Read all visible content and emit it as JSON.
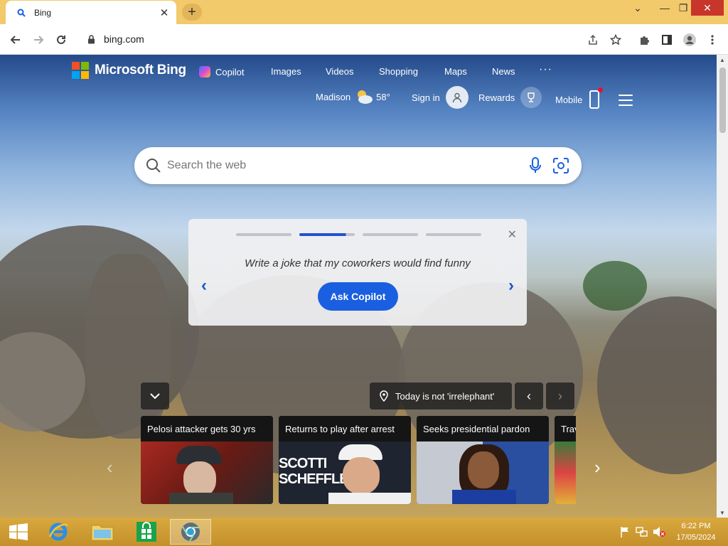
{
  "browser": {
    "tab_title": "Bing",
    "tab_close": "✕",
    "new_tab": "+",
    "url": "bing.com",
    "win_minimize": "—",
    "win_restore": "❐",
    "win_close": "✕",
    "win_dropdown": "⌄"
  },
  "bing": {
    "logo_text": "Microsoft Bing",
    "logo_colors": [
      "#f25022",
      "#7fba00",
      "#00a4ef",
      "#ffb900"
    ],
    "nav": {
      "copilot": "Copilot",
      "images": "Images",
      "videos": "Videos",
      "shopping": "Shopping",
      "maps": "Maps",
      "news": "News",
      "more": "···"
    },
    "weather": {
      "location": "Madison",
      "temp": "58°",
      "icon": "partly-cloudy-icon"
    },
    "sign_in": "Sign in",
    "rewards": "Rewards",
    "mobile": "Mobile"
  },
  "search": {
    "placeholder": "Search the web"
  },
  "copilot_card": {
    "prompt": "Write a joke that my coworkers would find funny",
    "button": "Ask Copilot",
    "close": "✕",
    "prev": "‹",
    "next": "›",
    "active_index": 1,
    "slide_count": 4
  },
  "fact": {
    "text": "Today is not 'irrelephant'",
    "prev": "‹",
    "next": "›"
  },
  "news": [
    {
      "title": "Pelosi attacker gets 30 yrs"
    },
    {
      "title": "Returns to play after arrest",
      "image_text": "SCOTTI SCHEFFLE"
    },
    {
      "title": "Seeks presidential pardon"
    },
    {
      "title": "Trav"
    }
  ],
  "news_nav": {
    "prev": "‹",
    "next": "›"
  },
  "taskbar": {
    "time": "6:22 PM",
    "date": "17/05/2024"
  },
  "colors": {
    "accent": "#1a5fe0",
    "tabstrip": "#f2c96b",
    "taskbar": "#c58f2a"
  }
}
